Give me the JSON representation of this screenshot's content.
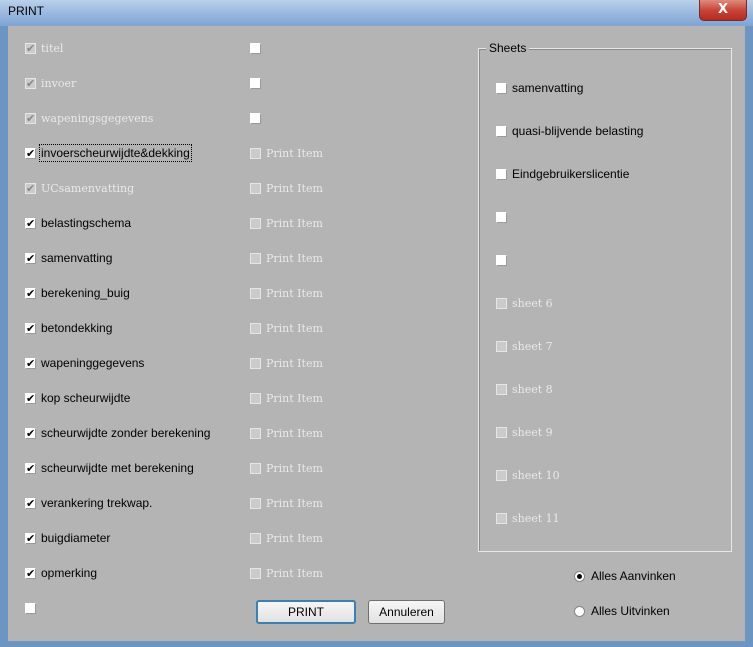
{
  "window": {
    "title": "PRINT",
    "close_glyph": "X"
  },
  "col1": [
    {
      "label": "titel",
      "checked": true,
      "disabled": true
    },
    {
      "label": "invoer",
      "checked": true,
      "disabled": true
    },
    {
      "label": "wapeningsgegevens",
      "checked": true,
      "disabled": true
    },
    {
      "label": "invoerscheurwijdte&dekking",
      "checked": true,
      "disabled": false,
      "focused": true
    },
    {
      "label": "UCsamenvatting",
      "checked": true,
      "disabled": true
    },
    {
      "label": "belastingschema",
      "checked": true,
      "disabled": false
    },
    {
      "label": "samenvatting",
      "checked": true,
      "disabled": false
    },
    {
      "label": "berekening_buig",
      "checked": true,
      "disabled": false
    },
    {
      "label": "betondekking",
      "checked": true,
      "disabled": false
    },
    {
      "label": "wapeninggegevens",
      "checked": true,
      "disabled": false
    },
    {
      "label": "kop scheurwijdte",
      "checked": true,
      "disabled": false
    },
    {
      "label": "scheurwijdte zonder berekening",
      "checked": true,
      "disabled": false
    },
    {
      "label": "scheurwijdte met berekening",
      "checked": true,
      "disabled": false
    },
    {
      "label": "verankering trekwap.",
      "checked": true,
      "disabled": false
    },
    {
      "label": "buigdiameter",
      "checked": true,
      "disabled": false
    },
    {
      "label": "opmerking",
      "checked": true,
      "disabled": false
    },
    {
      "label": "",
      "checked": false,
      "disabled": false
    }
  ],
  "col2": [
    {
      "label": "",
      "disabled": false
    },
    {
      "label": "",
      "disabled": false
    },
    {
      "label": "",
      "disabled": false
    },
    {
      "label": "Print Item",
      "disabled": true
    },
    {
      "label": "Print Item",
      "disabled": true
    },
    {
      "label": "Print Item",
      "disabled": true
    },
    {
      "label": "Print Item",
      "disabled": true
    },
    {
      "label": "Print Item",
      "disabled": true
    },
    {
      "label": "Print Item",
      "disabled": true
    },
    {
      "label": "Print Item",
      "disabled": true
    },
    {
      "label": "Print Item",
      "disabled": true
    },
    {
      "label": "Print Item",
      "disabled": true
    },
    {
      "label": "Print Item",
      "disabled": true
    },
    {
      "label": "Print Item",
      "disabled": true
    },
    {
      "label": "Print Item",
      "disabled": true
    },
    {
      "label": "Print Item",
      "disabled": true
    }
  ],
  "sheets": {
    "title": "Sheets",
    "items": [
      {
        "label": "samenvatting",
        "disabled": false
      },
      {
        "label": "quasi-blijvende belasting",
        "disabled": false
      },
      {
        "label": "Eindgebruikerslicentie",
        "disabled": false
      },
      {
        "label": "",
        "disabled": false
      },
      {
        "label": "",
        "disabled": false
      },
      {
        "label": "sheet 6",
        "disabled": true
      },
      {
        "label": "sheet 7",
        "disabled": true
      },
      {
        "label": "sheet 8",
        "disabled": true
      },
      {
        "label": "sheet 9",
        "disabled": true
      },
      {
        "label": "sheet 10",
        "disabled": true
      },
      {
        "label": "sheet 11",
        "disabled": true
      }
    ]
  },
  "radios": [
    {
      "label": "Alles Aanvinken",
      "selected": true
    },
    {
      "label": "Alles Uitvinken",
      "selected": false
    }
  ],
  "buttons": {
    "print": "PRINT",
    "cancel": "Annuleren"
  },
  "icons": {
    "check": "✔",
    "close": "close-icon"
  }
}
